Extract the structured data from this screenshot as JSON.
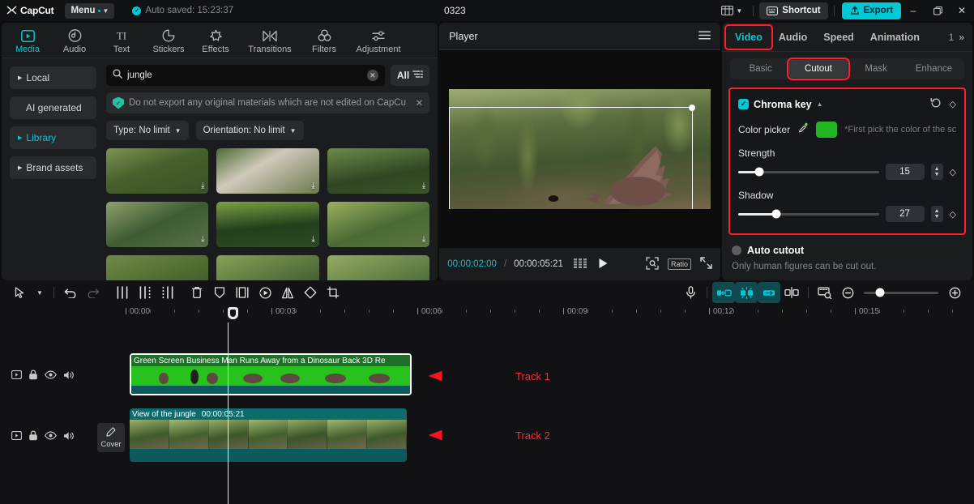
{
  "titlebar": {
    "logo": "CapCut",
    "menu_label": "Menu",
    "autosave": "Auto saved: 15:23:37",
    "project_title": "0323",
    "shortcut_label": "Shortcut",
    "export_label": "Export",
    "minimize": "–",
    "maximize": "❐",
    "close": "✕",
    "accent": "#00c8d4"
  },
  "media": {
    "categories": [
      {
        "label": "Media",
        "icon": "media-icon",
        "active": true
      },
      {
        "label": "Audio",
        "icon": "audio-icon",
        "active": false
      },
      {
        "label": "Text",
        "icon": "text-icon",
        "active": false
      },
      {
        "label": "Stickers",
        "icon": "stickers-icon",
        "active": false
      },
      {
        "label": "Effects",
        "icon": "effects-icon",
        "active": false
      },
      {
        "label": "Transitions",
        "icon": "transitions-icon",
        "active": false
      },
      {
        "label": "Filters",
        "icon": "filters-icon",
        "active": false
      },
      {
        "label": "Adjustment",
        "icon": "adjustment-icon",
        "active": false
      }
    ],
    "sidebar": [
      {
        "label": "Local",
        "arrow": true,
        "active": false
      },
      {
        "label": "AI generated",
        "arrow": false,
        "active": false
      },
      {
        "label": "Library",
        "arrow": true,
        "active": true
      },
      {
        "label": "Brand assets",
        "arrow": true,
        "active": false
      }
    ],
    "search": {
      "value": "jungle",
      "placeholder": "Search",
      "clear": "✕"
    },
    "all_label": "All",
    "notice": "Do not export any original materials which are not edited on CapCu",
    "notice_close": "✕",
    "filters": [
      {
        "label": "Type: No limit"
      },
      {
        "label": "Orientation: No limit"
      }
    ],
    "thumb_count": 9
  },
  "player": {
    "title": "Player",
    "current_time": "00:00:02:00",
    "separator": "/",
    "total_time": "00:00:05:21",
    "play_icon": "play-icon",
    "ratio_label": "Ratio"
  },
  "right_panel": {
    "tabs": [
      {
        "label": "Video",
        "active": true,
        "highlighted": true
      },
      {
        "label": "Audio",
        "active": false,
        "highlighted": false
      },
      {
        "label": "Speed",
        "active": false,
        "highlighted": false
      },
      {
        "label": "Animation",
        "active": false,
        "highlighted": false
      }
    ],
    "tab_overflow": "»",
    "sub_tabs": [
      {
        "label": "Basic",
        "active": false,
        "highlighted": false
      },
      {
        "label": "Cutout",
        "active": true,
        "highlighted": true
      },
      {
        "label": "Mask",
        "active": false,
        "highlighted": false
      },
      {
        "label": "Enhance",
        "active": false,
        "highlighted": false
      }
    ],
    "chroma_key": {
      "title": "Chroma key",
      "enabled": true,
      "color_picker_label": "Color picker",
      "picker_color": "#22b522",
      "hint": "*First pick the color of the scre...",
      "strength": {
        "label": "Strength",
        "value": "15",
        "percent": 15
      },
      "shadow": {
        "label": "Shadow",
        "value": "27",
        "percent": 27
      },
      "reset_icon": "reset-icon",
      "keyframe_icon": "keyframe-diamond-icon"
    },
    "auto_cutout": {
      "title": "Auto cutout",
      "enabled": false,
      "subtitle": "Only human figures can be cut out."
    },
    "highlight_color": "#ff1f2e"
  },
  "timeline": {
    "tools_left": [
      {
        "name": "select-cursor-icon",
        "dim": false
      },
      {
        "name": "cursor-dropdown-icon",
        "dim": false
      },
      {
        "name": "undo-icon",
        "dim": false
      },
      {
        "name": "redo-icon",
        "dim": true
      },
      {
        "name": "split-icon",
        "dim": false
      },
      {
        "name": "trim-left-icon",
        "dim": false
      },
      {
        "name": "trim-right-icon",
        "dim": false
      },
      {
        "name": "delete-icon",
        "dim": false
      },
      {
        "name": "freeze-icon",
        "dim": false
      },
      {
        "name": "mirror-frame-icon",
        "dim": false
      },
      {
        "name": "reverse-icon",
        "dim": false
      },
      {
        "name": "flip-icon",
        "dim": false
      },
      {
        "name": "rotate-icon",
        "dim": false
      },
      {
        "name": "crop-icon",
        "dim": false
      }
    ],
    "tools_right": [
      {
        "name": "microphone-icon",
        "highlight": false
      },
      {
        "name": "auto-align-left-icon",
        "highlight": true
      },
      {
        "name": "auto-align-center-icon",
        "highlight": true
      },
      {
        "name": "auto-align-right-icon",
        "highlight": true
      },
      {
        "name": "split-marker-icon",
        "highlight": false
      },
      {
        "name": "keyframe-panel-icon",
        "highlight": false
      },
      {
        "name": "zoom-out-icon",
        "highlight": false
      },
      {
        "name": "zoom-in-icon",
        "highlight": false
      }
    ],
    "ruler_labels": [
      "00:00",
      "00:03",
      "00:06",
      "00:09",
      "00:12",
      "00:15"
    ],
    "track_controls": [
      "video-toggle-icon",
      "lock-icon",
      "eye-icon",
      "volume-icon"
    ],
    "cover_label": "Cover",
    "tracks": [
      {
        "clip_title": "Green Screen Business Man Runs Away from a Dinosaur Back 3D Re",
        "duration": "",
        "selected": true,
        "type": "green-screen"
      },
      {
        "clip_title": "View of the jungle",
        "duration": "00:00:05:21",
        "selected": false,
        "type": "jungle"
      }
    ],
    "annotations": [
      {
        "label": "Track 1",
        "color": "#ff2a36"
      },
      {
        "label": "Track 2",
        "color": "#ff2a36"
      }
    ]
  }
}
